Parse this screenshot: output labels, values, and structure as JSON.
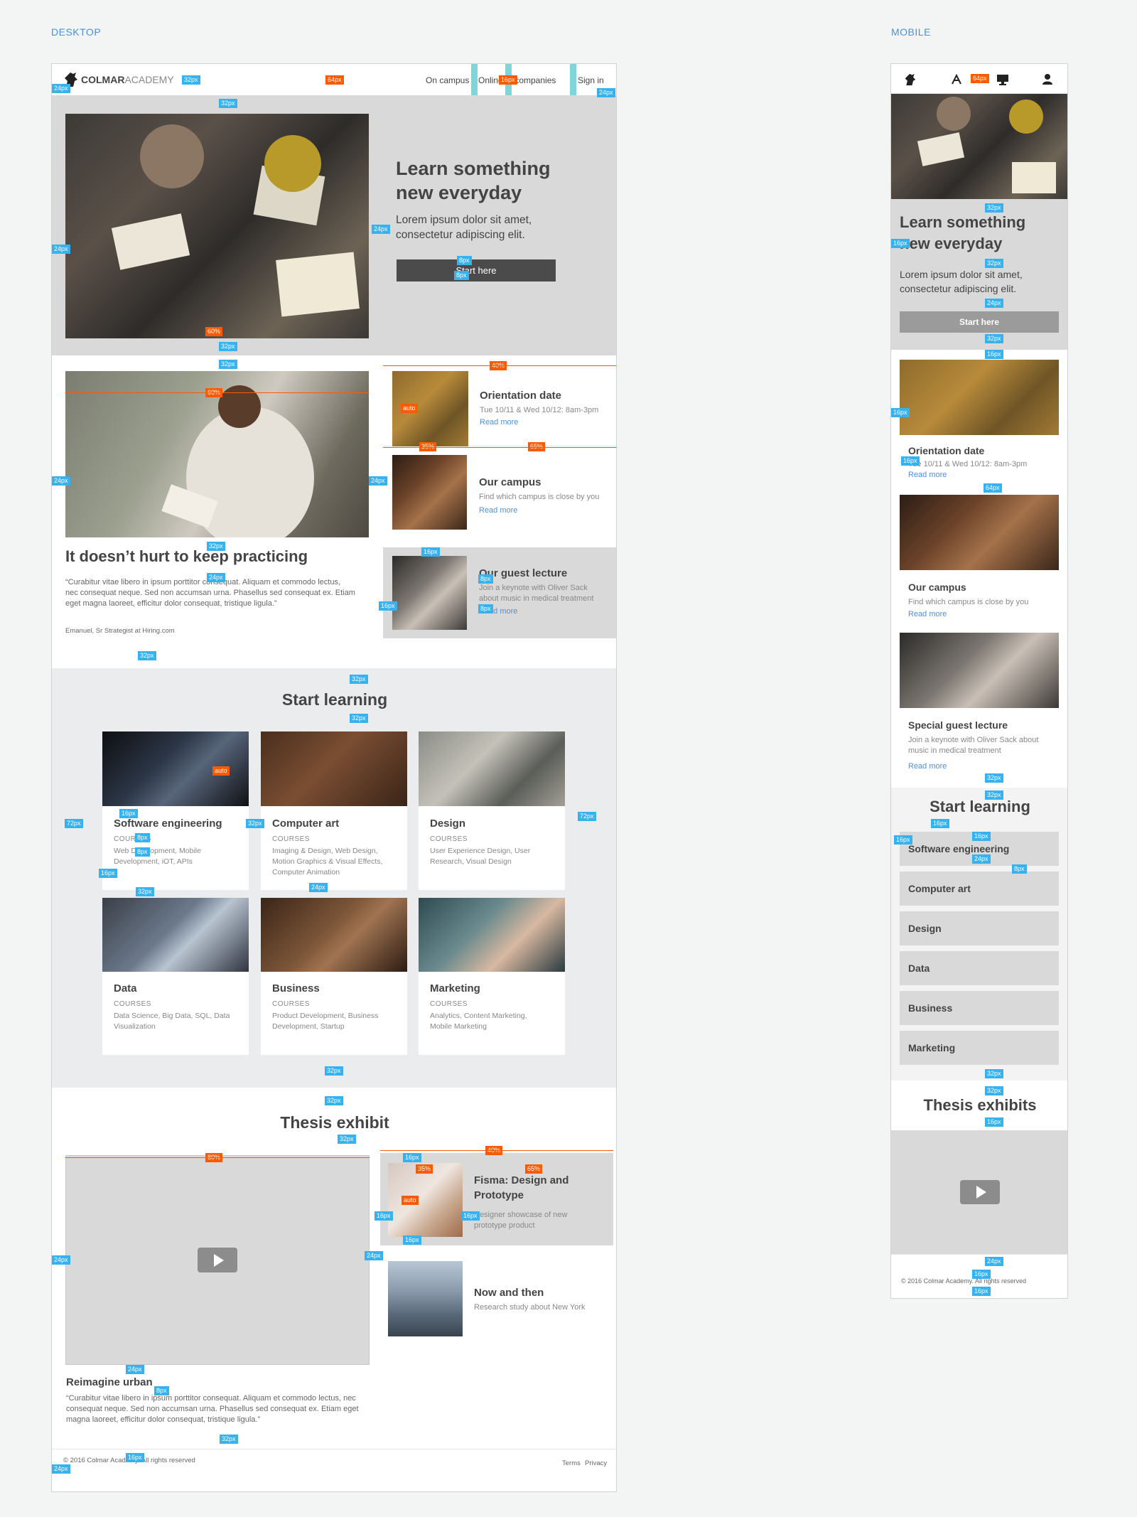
{
  "labels": {
    "desktop": "DESKTOP",
    "mobile": "MOBILE"
  },
  "brand": {
    "bold": "COLMAR",
    "light": "ACADEMY"
  },
  "nav": {
    "on_campus": "On campus",
    "online": "Online",
    "companies": "For companies",
    "sign_in": "Sign in"
  },
  "hero": {
    "title_line1": "Learn something",
    "title_line2": "new everyday",
    "sub_line1": "Lorem ipsum dolor sit amet,",
    "sub_line2": "consectetur adipiscing elit.",
    "cta": "Start here"
  },
  "practice": {
    "title": "It doesn’t hurt to keep practicing",
    "quote_l1": "“Curabitur vitae libero in ipsum porttitor consequat. Aliquam et commodo lectus,",
    "quote_l2": "nec consequat neque. Sed non accumsan urna. Phasellus sed consequat ex. Etiam",
    "quote_l3": "eget magna laoreet, efficitur dolor consequat, tristique ligula.”",
    "author": "Emanuel, Sr Strategist at Hiring.com"
  },
  "events": [
    {
      "title": "Orientation date",
      "sub": "Tue 10/11 & Wed 10/12: 8am-3pm",
      "link": "Read more"
    },
    {
      "title": "Our campus",
      "sub": "Find which campus is close by you",
      "link": "Read more"
    },
    {
      "title": "Our guest lecture",
      "sub_l1": "Join a keynote with Oliver Sack",
      "sub_l2": "about music in medical treatment",
      "link": "Read more"
    }
  ],
  "start_learning": {
    "title": "Start learning",
    "kicker": "COURSES",
    "courses": [
      {
        "title": "Software engineering",
        "desc_l1": "Web Development, Mobile",
        "desc_l2": "Development, iOT, APIs",
        "desc_l3": ""
      },
      {
        "title": "Computer art",
        "desc_l1": "Imaging & Design, Web Design,",
        "desc_l2": "Motion Graphics & Visual Effects,",
        "desc_l3": "Computer Animation"
      },
      {
        "title": "Design",
        "desc_l1": "User Experience Design, User",
        "desc_l2": "Research, Visual Design",
        "desc_l3": ""
      },
      {
        "title": "Data",
        "desc_l1": "Data Science, Big Data, SQL, Data",
        "desc_l2": "Visualization",
        "desc_l3": ""
      },
      {
        "title": "Business",
        "desc_l1": "Product Development, Business",
        "desc_l2": "Development, Startup",
        "desc_l3": ""
      },
      {
        "title": "Marketing",
        "desc_l1": "Analytics, Content Marketing,",
        "desc_l2": "Mobile Marketing",
        "desc_l3": ""
      }
    ]
  },
  "thesis": {
    "title": "Thesis exhibit",
    "items": [
      {
        "title_l1": "Fisma: Design and",
        "title_l2": "Prototype",
        "sub_l1": "Designer showcase of new",
        "sub_l2": "prototype product"
      },
      {
        "title_l1": "Now and then",
        "title_l2": "",
        "sub_l1": "Research study about New York",
        "sub_l2": ""
      }
    ],
    "video_title": "Reimagine urban",
    "quote_l1": "“Curabitur vitae libero in ipsum porttitor consequat. Aliquam et commodo lectus, nec",
    "quote_l2": "consequat neque. Sed non accumsan urna. Phasellus sed consequat ex. Etiam eget",
    "quote_l3": "magna laoreet, efficitur dolor consequat, tristique ligula.”"
  },
  "footer": {
    "copyright": "© 2016 Colmar Academy. All rights reserved",
    "terms": "Terms",
    "privacy": "Privacy"
  },
  "mobile": {
    "hero_title_l1": "Learn something",
    "hero_title_l2": "new everyday",
    "hero_sub_l1": "Lorem ipsum dolor sit amet,",
    "hero_sub_l2": "consectetur adipiscing elit.",
    "cta": "Start here",
    "events": [
      {
        "title": "Orientation date",
        "sub": "Tue 10/11 & Wed 10/12: 8am-3pm",
        "link": "Read more"
      },
      {
        "title": "Our campus",
        "sub": "Find which campus is close by you",
        "link": "Read more"
      },
      {
        "title": "Special guest lecture",
        "sub_l1": "Join a keynote with Oliver Sack about",
        "sub_l2": "music in medical treatment",
        "link": "Read more"
      }
    ],
    "start_learning": "Start learning",
    "courses": [
      "Software engineering",
      "Computer art",
      "Design",
      "Data",
      "Business",
      "Marketing"
    ],
    "thesis": "Thesis exhibits",
    "copyright": "© 2016 Colmar Academy. All rights reserved"
  },
  "annotations": {
    "a32": "32px",
    "a64": "64px",
    "a24": "24px",
    "a16": "16px",
    "a8": "8px",
    "a72": "72px",
    "p60": "60%",
    "p40": "40%",
    "p35": "35%",
    "p65": "65%",
    "p80": "80%",
    "auto": "auto"
  },
  "colors": {
    "accent": "#4a90e2",
    "annotation_blue": "#37b2f0",
    "annotation_orange": "#ff5a00",
    "hero_bg": "#d9d9d9",
    "section_bg": "#ebecee"
  }
}
